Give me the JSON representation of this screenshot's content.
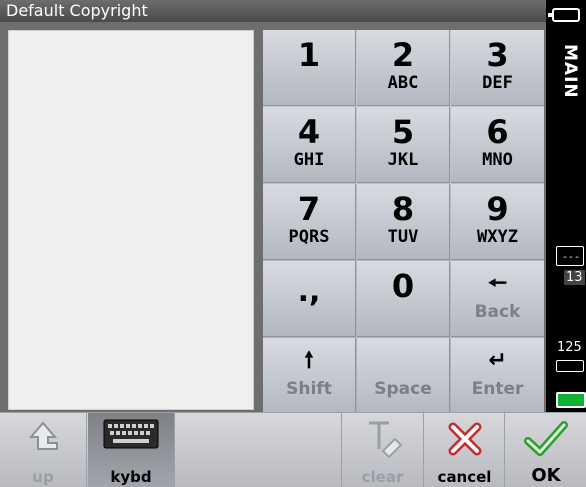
{
  "window": {
    "title": "Default Copyright"
  },
  "keypad": {
    "rows": [
      [
        {
          "num": "1",
          "letters": ""
        },
        {
          "num": "2",
          "letters": "ABC"
        },
        {
          "num": "3",
          "letters": "DEF"
        }
      ],
      [
        {
          "num": "4",
          "letters": "GHI"
        },
        {
          "num": "5",
          "letters": "JKL"
        },
        {
          "num": "6",
          "letters": "MNO"
        }
      ],
      [
        {
          "num": "7",
          "letters": "PQRS"
        },
        {
          "num": "8",
          "letters": "TUV"
        },
        {
          "num": "9",
          "letters": "WXYZ"
        }
      ]
    ],
    "punct": ".,",
    "zero": "0",
    "back_glyph": "🠔",
    "back_label": "Back",
    "shift_glyph": "🠕",
    "shift_label": "Shift",
    "space_label": "Space",
    "enter_glyph": "↵",
    "enter_label": "Enter"
  },
  "sidebar": {
    "main_label": "MAIN",
    "folder_text": "---",
    "page_number": "13",
    "counter": "125",
    "battery_color": "#11b233"
  },
  "toolbar": {
    "up_label": "up",
    "kybd_label": "kybd",
    "clear_label": "clear",
    "cancel_label": "cancel",
    "ok_label": "OK",
    "cancel_color": "#c62a2a",
    "ok_color": "#2f9b2f"
  }
}
